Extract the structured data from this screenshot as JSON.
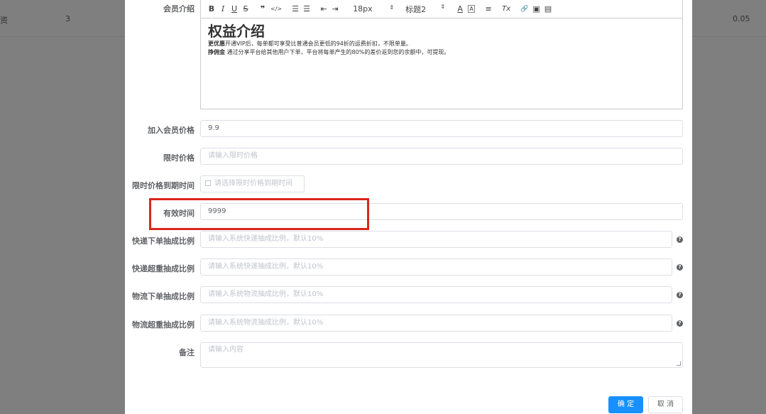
{
  "background": {
    "cell_left": "资",
    "cell_3": "3",
    "cell_right": "0.05"
  },
  "editor": {
    "label": "会员介绍",
    "toolbar": {
      "bold": "B",
      "italic": "I",
      "underline": "U",
      "strike": "S",
      "quote": "❞",
      "code": "</>",
      "ordered_list": "☰",
      "bullet_list": "☰",
      "outdent": "⇤",
      "indent": "⇥",
      "font_size": "18px",
      "heading": "标题2",
      "font_color": "A",
      "bg_color": "A",
      "align": "≡",
      "clear_format": "Tx",
      "link": "🔗",
      "image": "▣",
      "video": "▤",
      "select_arrow": "⇕"
    },
    "heading_text": "权益介绍",
    "p1_bold": "更优惠",
    "p1_text": "开通VIP后，每单都可享受比普通会员更低的94折的运费折扣，不限单量。",
    "p2_bold": "挣佣金",
    "p2_text": "通过分享平台给其他用户下单，平台将每单产生的80%的差价返到您的余额中，可提现。"
  },
  "fields": {
    "join_price": {
      "label": "加入会员价格",
      "value": "9.9"
    },
    "limit_price": {
      "label": "限时价格",
      "placeholder": "请输入限时价格"
    },
    "limit_expire": {
      "label": "限时价格到期时间",
      "placeholder": "请选择限时价格到期时间"
    },
    "valid_time": {
      "label": "有效时间",
      "value": "9999"
    },
    "express_order_ratio": {
      "label": "快递下单抽成比例",
      "placeholder": "请输入系统快递抽成比例，默认10%"
    },
    "express_overweight_ratio": {
      "label": "快递超重抽成比例",
      "placeholder": "请输入系统快递抽成比例，默认10%"
    },
    "logistics_order_ratio": {
      "label": "物流下单抽成比例",
      "placeholder": "请输入系统物流抽成比例，默认10%"
    },
    "logistics_overweight_ratio": {
      "label": "物流超重抽成比例",
      "placeholder": "请输入系统物流抽成比例，默认10%"
    },
    "remark": {
      "label": "备注",
      "placeholder": "请输入内容"
    }
  },
  "help_icon": "?",
  "buttons": {
    "confirm": "确 定",
    "cancel": "取 消"
  },
  "colors": {
    "primary": "#1890ff",
    "highlight": "#d9261c"
  }
}
